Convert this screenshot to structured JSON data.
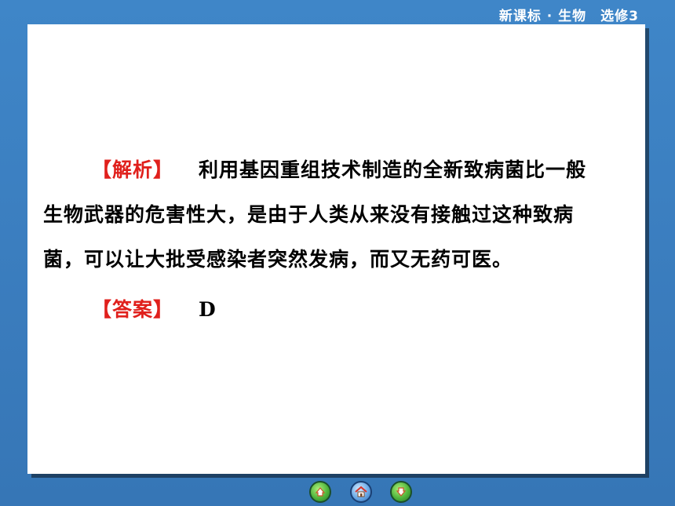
{
  "header": {
    "course": "新课标 · 生物",
    "module": "选修3"
  },
  "content": {
    "analysis": {
      "tag": "【解析】",
      "lines": [
        "利用基因重组技术制造的全新致病菌比一般",
        "生物武器的危害性大，是由于人类从来没有接触过这种致病",
        "菌，可以让大批受感染者突然发病，而又无药可医。"
      ]
    },
    "answer": {
      "tag": "【答案】",
      "value": "D"
    }
  },
  "nav": {
    "prev_icon": "previous-page-icon",
    "home_icon": "home-icon",
    "next_icon": "next-page-icon"
  },
  "colors": {
    "background": "#3a7fc0",
    "panel": "#ffffff",
    "tag": "#e0201c",
    "text": "#000000"
  }
}
